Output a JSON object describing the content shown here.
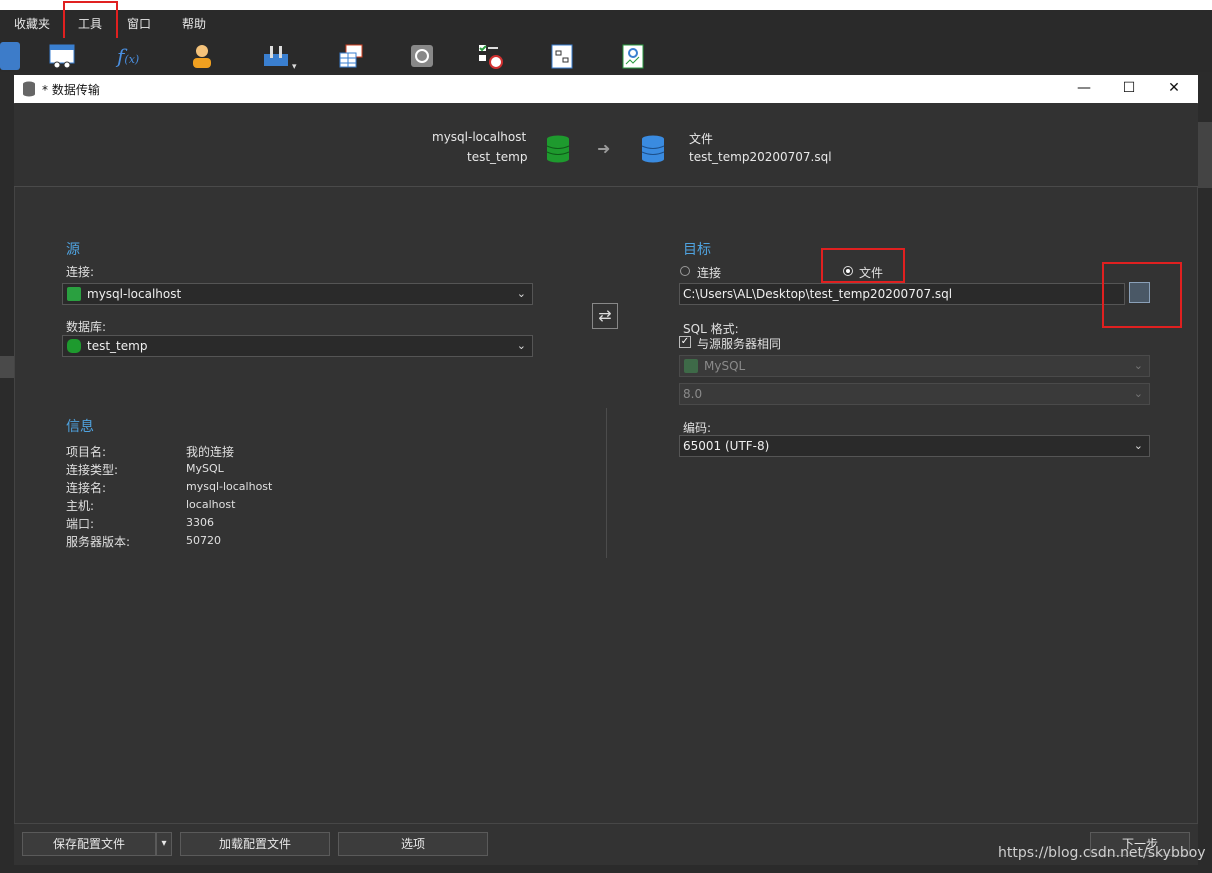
{
  "menu": {
    "items": [
      "收藏夹",
      "工具",
      "窗口",
      "帮助"
    ]
  },
  "toolbar": {
    "icons": [
      "table-icon",
      "function-icon",
      "user-icon",
      "tools-icon",
      "grid-icon",
      "restore-icon",
      "schedule-icon",
      "model-icon",
      "report-icon"
    ]
  },
  "dialog": {
    "title": "* 数据传输",
    "window_controls": {
      "minimize": "—",
      "maximize": "☐",
      "close": "✕"
    }
  },
  "header": {
    "source_conn": "mysql-localhost",
    "source_db": "test_temp",
    "arrow": "➜",
    "target_type": "文件",
    "target_file": "test_temp20200707.sql"
  },
  "source": {
    "title": "源",
    "connection_label": "连接:",
    "connection_value": "mysql-localhost",
    "database_label": "数据库:",
    "database_value": "test_temp"
  },
  "swap_glyph": "⇄",
  "info": {
    "title": "信息",
    "rows": [
      {
        "key": "项目名:",
        "value": "我的连接"
      },
      {
        "key": "连接类型:",
        "value": "MySQL"
      },
      {
        "key": "连接名:",
        "value": "mysql-localhost"
      },
      {
        "key": "主机:",
        "value": "localhost"
      },
      {
        "key": "端口:",
        "value": "3306"
      },
      {
        "key": "服务器版本:",
        "value": "50720"
      }
    ]
  },
  "target": {
    "title": "目标",
    "radio_connection": "连接",
    "radio_file": "文件",
    "selected": "file",
    "file_path": "C:\\Users\\AL\\Desktop\\test_temp20200707.sql",
    "sql_format_label": "SQL 格式:",
    "same_as_source_label": "与源服务器相同",
    "same_as_source_checked": true,
    "server_type": "MySQL",
    "server_version": "8.0",
    "encoding_label": "编码:",
    "encoding_value": "65001 (UTF-8)"
  },
  "footer": {
    "save_profile": "保存配置文件",
    "load_profile": "加载配置文件",
    "options": "选项",
    "next": "下一步"
  },
  "watermark": "https://blog.csdn.net/skybboy",
  "colors": {
    "accent": "#4fa3e0",
    "highlight": "#e02020",
    "db_green": "#1e9a2e",
    "db_blue": "#3a8be0"
  }
}
